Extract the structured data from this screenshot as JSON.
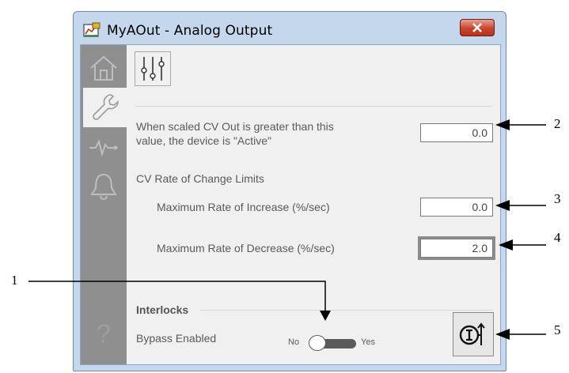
{
  "window": {
    "title": "MyAOut - Analog Output",
    "close_icon": "close-x-icon"
  },
  "nav": {
    "items": [
      {
        "icon": "home-icon",
        "active": false
      },
      {
        "icon": "wrench-icon",
        "active": true
      },
      {
        "icon": "trend-icon",
        "active": false
      },
      {
        "icon": "bell-icon",
        "active": false
      }
    ],
    "help_label": "?"
  },
  "content": {
    "tab_icon": "sliders-icon",
    "active_threshold_label_line1": "When scaled CV Out is greater than this",
    "active_threshold_label_line2": "value, the device is \"Active\"",
    "active_threshold_value": "0.0",
    "rate_limits_heading": "CV Rate of Change Limits",
    "max_increase_label": "Maximum Rate of Increase (%/sec)",
    "max_increase_value": "0.0",
    "max_decrease_label": "Maximum Rate of Decrease (%/sec)",
    "max_decrease_value": "2.0",
    "interlocks_heading": "Interlocks",
    "bypass_label": "Bypass Enabled",
    "toggle_no": "No",
    "toggle_yes": "Yes",
    "bypass_enabled": false,
    "interlock_button_icon": "interlock-icon"
  },
  "callouts": {
    "c1": "1",
    "c2": "2",
    "c3": "3",
    "c4": "4",
    "c5": "5"
  },
  "colors": {
    "window_frame": "#c4d7ec",
    "close_button": "#c8452c",
    "nav_background": "#8f8f8f",
    "panel_background": "#f0f0f0"
  }
}
